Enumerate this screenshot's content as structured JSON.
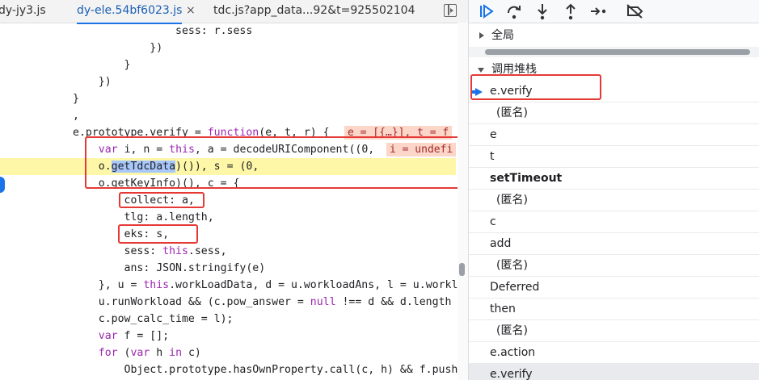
{
  "tabs": [
    {
      "label": "dy-jy3.js",
      "active": false
    },
    {
      "label": "dy-ele.54bf6023.js",
      "active": true
    },
    {
      "label": "tdc.js?app_data...92&t=925502104",
      "active": false
    }
  ],
  "close_glyph": "×",
  "code_lines": [
    {
      "indent": "                ",
      "text": "sess: r.sess"
    },
    {
      "indent": "            ",
      "text": "})"
    },
    {
      "indent": "        ",
      "text": "}"
    },
    {
      "indent": "    ",
      "text": "})"
    },
    {
      "indent": "",
      "text": "}"
    },
    {
      "indent": "",
      "text": ","
    },
    {
      "indent": "",
      "text": "e.prototype.verify = function(e, t, r) {"
    },
    {
      "indent": "    ",
      "text": "var i, n = this, a = decodeURIComponent((0,"
    },
    {
      "indent": "    ",
      "text": "o.getTdcData)()), s = (0,"
    },
    {
      "indent": "    ",
      "text": "o.getKeyInfo)(), c = {"
    },
    {
      "indent": "        ",
      "text": "collect: a,"
    },
    {
      "indent": "        ",
      "text": "tlg: a.length,"
    },
    {
      "indent": "        ",
      "text": "eks: s,"
    },
    {
      "indent": "        ",
      "text": "sess: this.sess,"
    },
    {
      "indent": "        ",
      "text": "ans: JSON.stringify(e)"
    },
    {
      "indent": "    ",
      "text": "}, u = this.workLoadData, d = u.workloadAns, l = u.workl"
    },
    {
      "indent": "    ",
      "text": "u.runWorkload && (c.pow_answer = null !== d && d.length"
    },
    {
      "indent": "    ",
      "text": "c.pow_calc_time = l);"
    },
    {
      "indent": "    ",
      "text": "var f = [];"
    },
    {
      "indent": "    ",
      "text": "for (var h in c)"
    },
    {
      "indent": "        ",
      "text": "Object.prototype.hasOwnProperty.call(c, h) && f.push"
    }
  ],
  "inline_values": {
    "verify_line": "e = [{…}], t = f",
    "var_line": "i = undefi"
  },
  "selection_text": "getTdcData",
  "toolbar_icons": [
    "resume-icon",
    "step-over-icon",
    "step-into-icon",
    "step-out-icon",
    "step-icon",
    "deactivate-breakpoints-icon"
  ],
  "global_section": "全局",
  "callstack_section": "调用堆栈",
  "call_frames": [
    {
      "label": "e.verify",
      "type": "current"
    },
    {
      "label": "(匿名)",
      "type": "anon"
    },
    {
      "label": "e",
      "type": "normal"
    },
    {
      "label": "t",
      "type": "normal"
    },
    {
      "label": "setTimeout",
      "type": "bold"
    },
    {
      "label": "(匿名)",
      "type": "anon"
    },
    {
      "label": "c",
      "type": "normal"
    },
    {
      "label": "add",
      "type": "normal"
    },
    {
      "label": "(匿名)",
      "type": "anon"
    },
    {
      "label": "Deferred",
      "type": "normal"
    },
    {
      "label": "then",
      "type": "normal"
    },
    {
      "label": "(匿名)",
      "type": "anon"
    },
    {
      "label": "e.action",
      "type": "normal"
    },
    {
      "label": "e.verify",
      "type": "hl"
    }
  ],
  "colors": {
    "accent": "#1a73e8",
    "annotation": "#e53935",
    "paused_line": "#fdf7a7"
  }
}
